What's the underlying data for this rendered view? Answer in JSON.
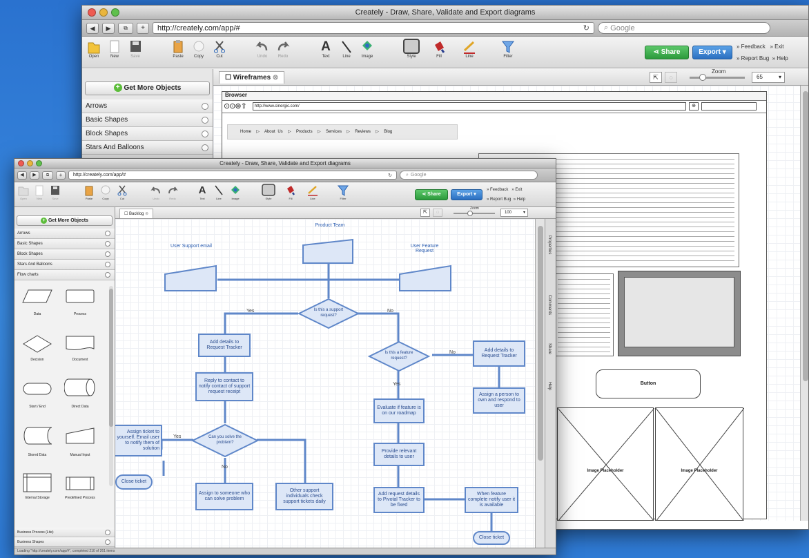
{
  "back_window": {
    "title": "Creately - Draw, Share, Validate and Export diagrams",
    "url": "http://creately.com/app/#",
    "search_placeholder": "Google",
    "toolbar": [
      "Open",
      "New",
      "Save",
      "Paste",
      "Copy",
      "Cut",
      "Undo",
      "Redo",
      "Text",
      "Line",
      "Image",
      "Style",
      "Fill",
      "Line",
      "Filter"
    ],
    "share_label": "Share",
    "export_label": "Export",
    "links": [
      "Feedback",
      "Exit",
      "Report Bug",
      "Help"
    ],
    "get_more": "Get More Objects",
    "categories": [
      "Arrows",
      "Basic Shapes",
      "Block Shapes",
      "Stars And Balloons"
    ],
    "tab": "Wireframes",
    "zoom_label": "Zoom",
    "zoom_value": "65",
    "wireframe": {
      "browser_title": "Browser",
      "url": "http://www.cinergic.com/",
      "nav": [
        "Home",
        "About Us",
        "Products",
        "Services",
        "Reviews",
        "Blog"
      ],
      "button": "Button",
      "image_placeholder": "Image Placeholder"
    }
  },
  "front_window": {
    "title": "Creately - Draw, Share, Validate and Export diagrams",
    "url": "http://creately.com/app/#",
    "search_placeholder": "Google",
    "toolbar": [
      "Open",
      "New",
      "Save",
      "Paste",
      "Copy",
      "Cut",
      "Undo",
      "Redo",
      "Text",
      "Line",
      "Image",
      "Style",
      "Fill",
      "Line",
      "Filter"
    ],
    "share_label": "Share",
    "export_label": "Export",
    "links": [
      "Feedback",
      "Exit",
      "Report Bug",
      "Help"
    ],
    "get_more": "Get More Objects",
    "categories": [
      "Arrows",
      "Basic Shapes",
      "Block Shapes",
      "Stars And Balloons",
      "Flow charts"
    ],
    "shapes": [
      "Data",
      "Process",
      "Decision",
      "Document",
      "Start / End",
      "Direct Data",
      "Stored Data",
      "Manual Input",
      "Internal Storage",
      "Predefined Process"
    ],
    "bottom_categories": [
      "Business Process (Lite)",
      "Business Shapes"
    ],
    "tab": "Backlog",
    "zoom_label": "Zoom",
    "zoom_value": "100",
    "side_tabs": [
      "Properties",
      "Comments",
      "Share",
      "Help"
    ],
    "status": "Loading \"http://creately.com/app/#\", completed 210 of 261 items"
  },
  "flowchart": {
    "title": "Product Team",
    "user_support": "User Support email",
    "user_feature": "User Feature Request",
    "is_support": "Is this a support request?",
    "is_feature": "Is this a feature request?",
    "add_details_1": "Add details to Request Tracker",
    "add_details_2": "Add details to Request Tracker",
    "reply_contact": "Reply to contact to notify contact of support request receipt",
    "can_solve": "Can you solve the problem?",
    "assign_self": "Assign ticket to yourself. Email user to notify them of solution",
    "close_ticket_1": "Close ticket",
    "assign_someone": "Assign to someone who can solve problem",
    "other_support": "Other support individuals check support tickets daily",
    "evaluate": "Evaluate if feature is on our roadmap",
    "assign_person": "Assign a person to own and respond to user",
    "provide_details": "Provide relevant details to user",
    "add_request": "Add request details to Pivotal Tracker to be fixed",
    "when_complete": "When feature complete notify user it is available",
    "close_ticket_2": "Close ticket",
    "yes": "Yes",
    "no": "No"
  }
}
